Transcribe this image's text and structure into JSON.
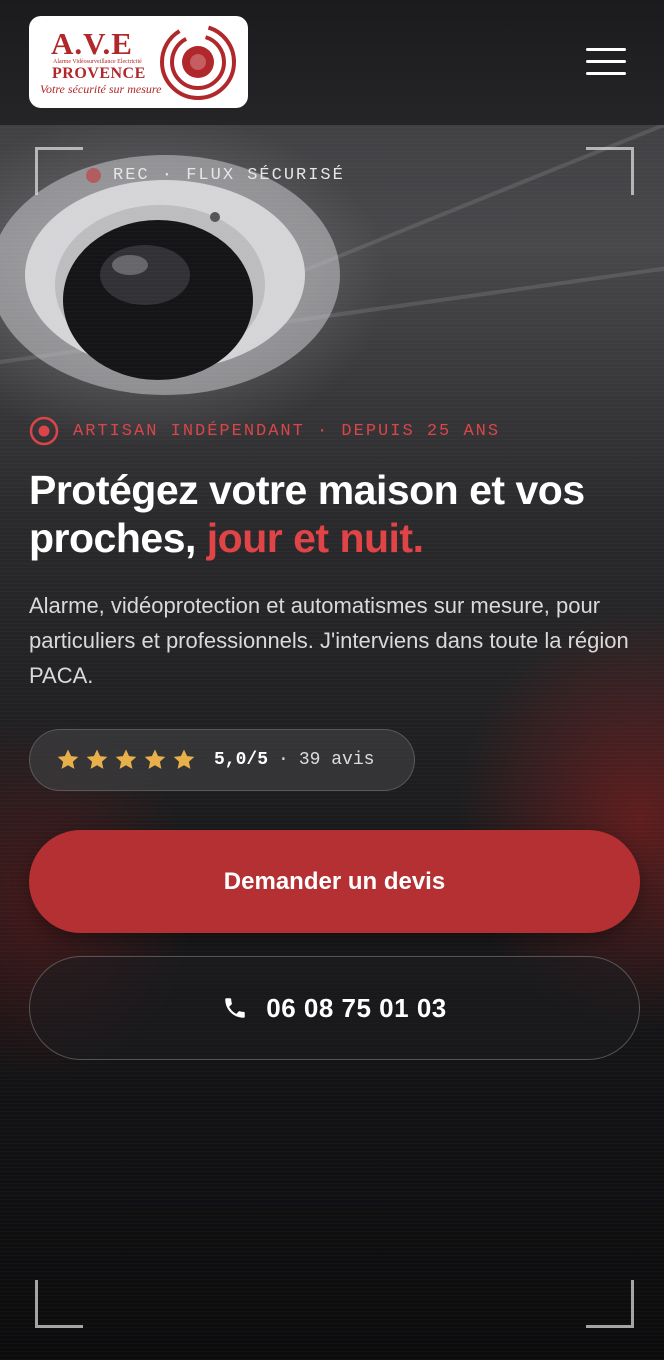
{
  "header": {
    "logo": {
      "name": "A.V.E",
      "subtitle": "Alarme Vidéosurveillance Electricité",
      "region": "PROVENCE",
      "tagline": "Votre sécurité sur mesure"
    },
    "menu_icon": "hamburger-icon"
  },
  "hero": {
    "rec_label": "REC · FLUX SÉCURISÉ",
    "eyebrow": "ARTISAN INDÉPENDANT · DEPUIS 25 ANS",
    "headline_main": "Protégez votre maison et vos proches, ",
    "headline_accent": "jour et nuit.",
    "lead": "Alarme, vidéoprotection et automatismes sur mesure, pour particuliers et professionnels. J'interviens dans toute la région PACA.",
    "rating": {
      "stars": 5,
      "score": "5,0/5",
      "separator": "·",
      "count": "39 avis"
    },
    "cta_quote": "Demander un devis",
    "cta_phone": "06 08 75 01 03"
  },
  "colors": {
    "brand_red": "#b53033",
    "accent_red": "#e04447",
    "star_gold": "#e8b04a",
    "background": "#0e0e10"
  }
}
